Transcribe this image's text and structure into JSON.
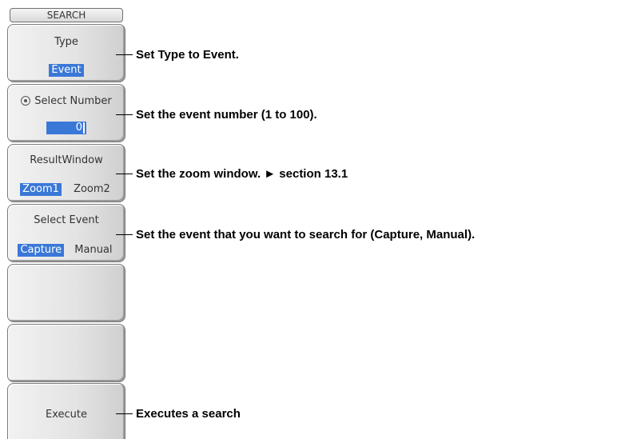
{
  "menu": {
    "title": "SEARCH"
  },
  "keys": {
    "type": {
      "label": "Type",
      "value": "Event"
    },
    "select_number": {
      "label": "Select Number",
      "value": "0"
    },
    "result_window": {
      "label": "ResultWindow",
      "options": [
        "Zoom1",
        "Zoom2"
      ],
      "selected": "Zoom1"
    },
    "select_event": {
      "label": "Select Event",
      "options": [
        "Capture",
        "Manual"
      ],
      "selected": "Capture"
    },
    "execute": {
      "label": "Execute"
    }
  },
  "callouts": {
    "type": "Set Type to Event.",
    "number": "Set the event number (1 to 100).",
    "zoom": "Set the zoom window. ► section 13.1",
    "event": "Set the event that you want to search for (Capture, Manual).",
    "execute": "Executes a search"
  },
  "colors": {
    "selected_bg": "#3a78d8",
    "key_bg": "#e3e3e3"
  },
  "icons": {
    "select_number": "rotary-knob-icon"
  }
}
